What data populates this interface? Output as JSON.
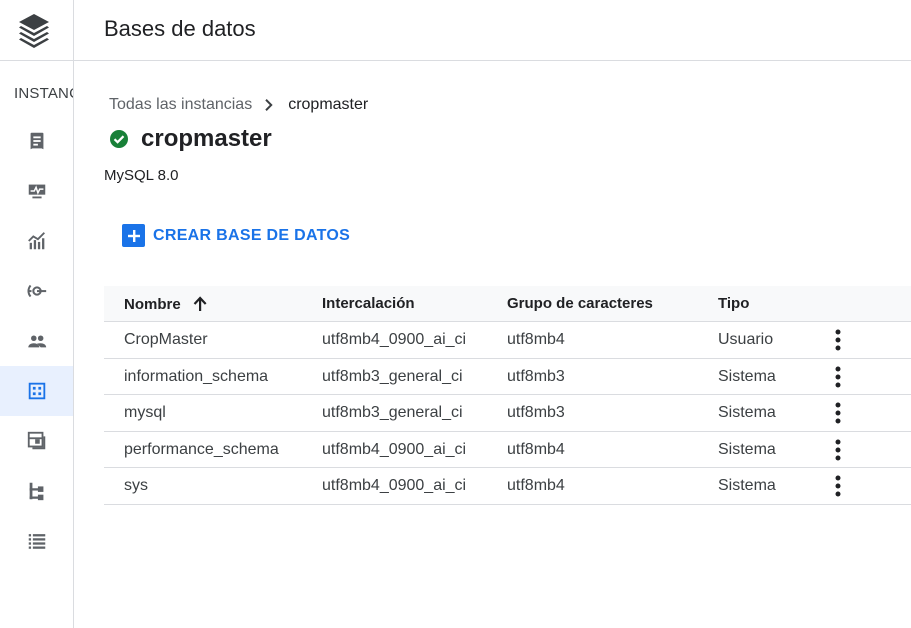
{
  "rail": {
    "label": "INSTANCIAS",
    "items": [
      {
        "icon": "overview-icon",
        "active": false
      },
      {
        "icon": "monitoring-icon",
        "active": false
      },
      {
        "icon": "query-insights-icon",
        "active": false
      },
      {
        "icon": "connections-icon",
        "active": false
      },
      {
        "icon": "users-icon",
        "active": false
      },
      {
        "icon": "databases-icon",
        "active": true
      },
      {
        "icon": "backups-icon",
        "active": false
      },
      {
        "icon": "replicas-icon",
        "active": false
      },
      {
        "icon": "operations-icon",
        "active": false
      }
    ]
  },
  "header": {
    "title": "Bases de datos"
  },
  "breadcrumb": {
    "parent": "Todas las instancias",
    "current": "cropmaster"
  },
  "instance": {
    "name": "cropmaster",
    "version": "MySQL 8.0",
    "status_color": "#188038"
  },
  "actions": {
    "create_label": "CREAR BASE DE DATOS"
  },
  "table": {
    "headers": {
      "name": "Nombre",
      "collation": "Intercalación",
      "charset": "Grupo de caracteres",
      "type": "Tipo"
    },
    "rows": [
      {
        "name": "CropMaster",
        "collation": "utf8mb4_0900_ai_ci",
        "charset": "utf8mb4",
        "type": "Usuario"
      },
      {
        "name": "information_schema",
        "collation": "utf8mb3_general_ci",
        "charset": "utf8mb3",
        "type": "Sistema"
      },
      {
        "name": "mysql",
        "collation": "utf8mb3_general_ci",
        "charset": "utf8mb3",
        "type": "Sistema"
      },
      {
        "name": "performance_schema",
        "collation": "utf8mb4_0900_ai_ci",
        "charset": "utf8mb4",
        "type": "Sistema"
      },
      {
        "name": "sys",
        "collation": "utf8mb4_0900_ai_ci",
        "charset": "utf8mb4",
        "type": "Sistema"
      }
    ]
  },
  "colors": {
    "accent": "#1a73e8",
    "active_bg": "#e8f0fe",
    "icon_gray": "#5f6368"
  }
}
